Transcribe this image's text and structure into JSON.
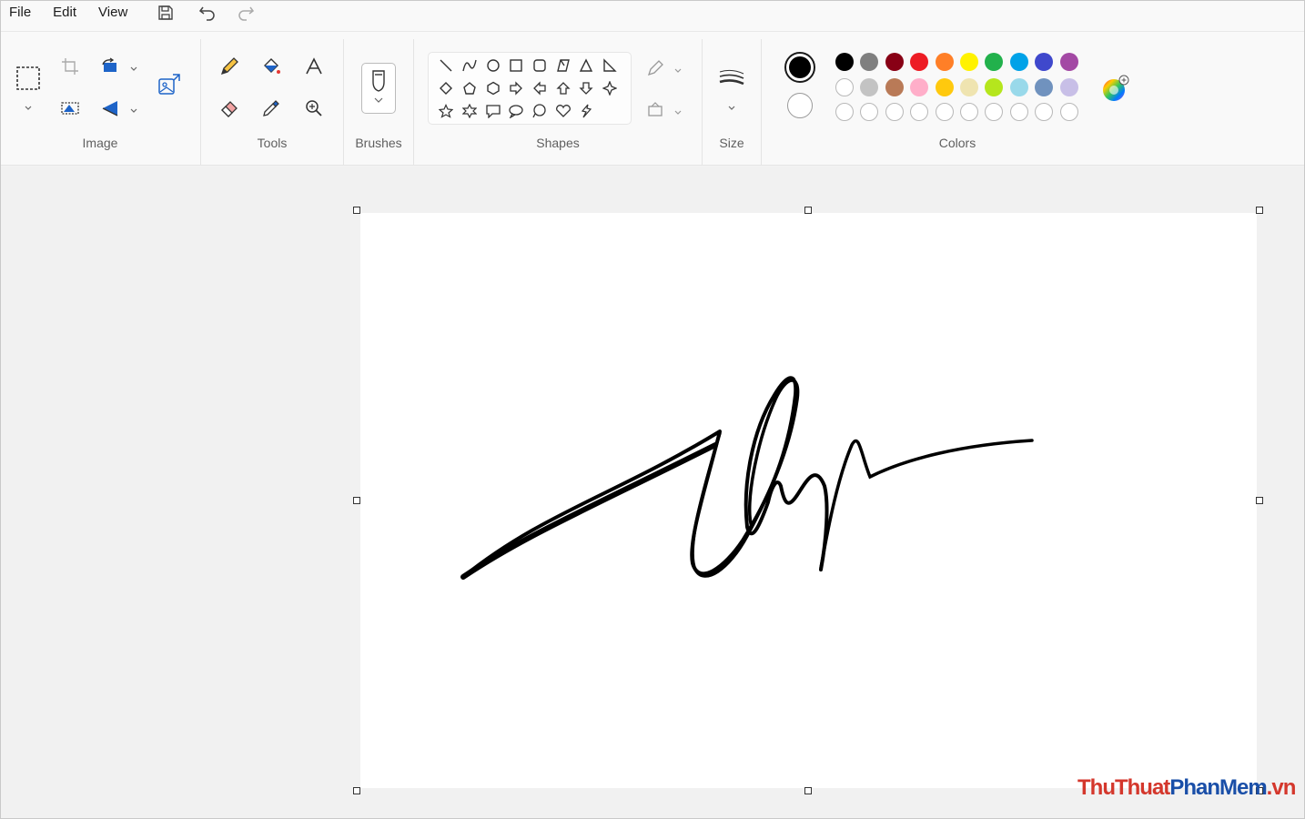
{
  "menu": {
    "file": "File",
    "edit": "Edit",
    "view": "View"
  },
  "quick_access": [
    "save-icon",
    "undo-icon",
    "redo-icon"
  ],
  "groups": {
    "image": "Image",
    "tools": "Tools",
    "brushes": "Brushes",
    "shapes": "Shapes",
    "size": "Size",
    "colors": "Colors"
  },
  "colors": {
    "primary": "#000000",
    "secondary": "#ffffff",
    "palette_row1": [
      "#000000",
      "#7f7f7f",
      "#880015",
      "#ed1c24",
      "#ff7f27",
      "#fff200",
      "#22b14c",
      "#00a2e8",
      "#3f48cc",
      "#a349a4"
    ],
    "palette_row2": [
      "#ffffff",
      "#c3c3c3",
      "#b97a57",
      "#ffaec9",
      "#ffc90e",
      "#efe4b0",
      "#b5e61d",
      "#99d9ea",
      "#7092be",
      "#c8bfe7"
    ]
  },
  "watermark": {
    "part1": "ThuThuat",
    "part2": "PhanMem",
    "part3": ".vn"
  }
}
